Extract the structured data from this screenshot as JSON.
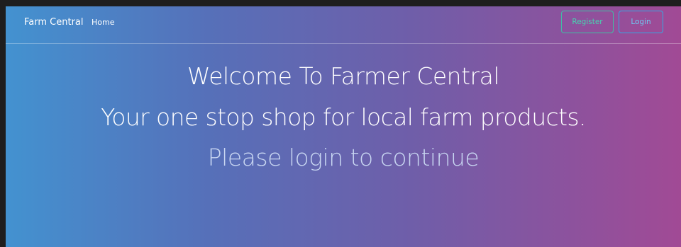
{
  "navbar": {
    "brand": "Farm Central",
    "links": [
      {
        "label": "Home"
      }
    ],
    "register_label": "Register",
    "login_label": "Login"
  },
  "hero": {
    "welcome": "Welcome To Farmer Central",
    "tagline": "Your one stop shop for local farm products.",
    "prompt": "Please login to continue"
  },
  "colors": {
    "gradient_start": "#4392d0",
    "gradient_end": "#a14a95",
    "register_accent": "#3ec1a4",
    "login_accent": "#34a9e4"
  }
}
